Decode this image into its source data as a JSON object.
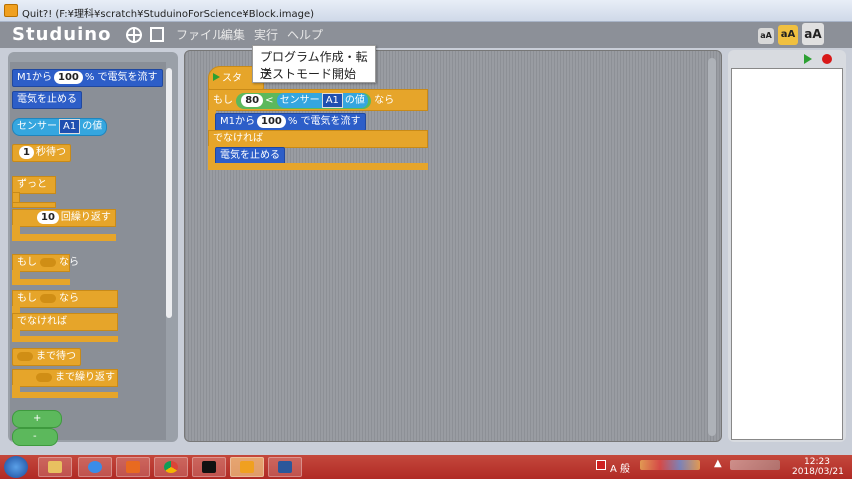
{
  "window": {
    "title": "Quit?! (F:¥理科¥scratch¥StuduinoForScience¥Block.image)"
  },
  "app": {
    "logo": "Studuino",
    "menu": [
      "ファイル",
      "編集",
      "実行",
      "ヘルプ"
    ],
    "size_buttons": [
      "aA",
      "aA",
      "aA"
    ]
  },
  "dropdown": {
    "items": [
      "プログラム作成・転送",
      "テストモード開始"
    ]
  },
  "palette": {
    "motor_run": {
      "pre": "M1から",
      "val": "100",
      "post": "% で電気を流す"
    },
    "motor_stop": "電気を止める",
    "sensor": {
      "pre": "センサー",
      "port": "A1",
      "post": "の値"
    },
    "wait": {
      "val": "1",
      "post": "秒待つ"
    },
    "forever": "ずっと",
    "repeat": {
      "val": "10",
      "post": "回繰り返す"
    },
    "if": {
      "pre": "もし",
      "post": "なら"
    },
    "if_else": {
      "pre": "もし",
      "post": "なら",
      "else": "でなければ"
    },
    "wait_until": "まで待つ",
    "repeat_until": "まで繰り返す",
    "op_add": "+",
    "op_sub": "-"
  },
  "script": {
    "hat": "スタ",
    "if": {
      "pre": "もし",
      "val": "80",
      "op": "<",
      "sensor_pre": "センサー",
      "port": "A1",
      "sensor_post": "の値",
      "post": "なら"
    },
    "motor_run": {
      "pre": "M1から",
      "val": "100",
      "post": "% で電気を流す"
    },
    "else": "でなければ",
    "motor_stop": "電気を止める"
  },
  "taskbar": {
    "time": "12:23",
    "date": "2018/03/21",
    "ime": "A 般"
  }
}
